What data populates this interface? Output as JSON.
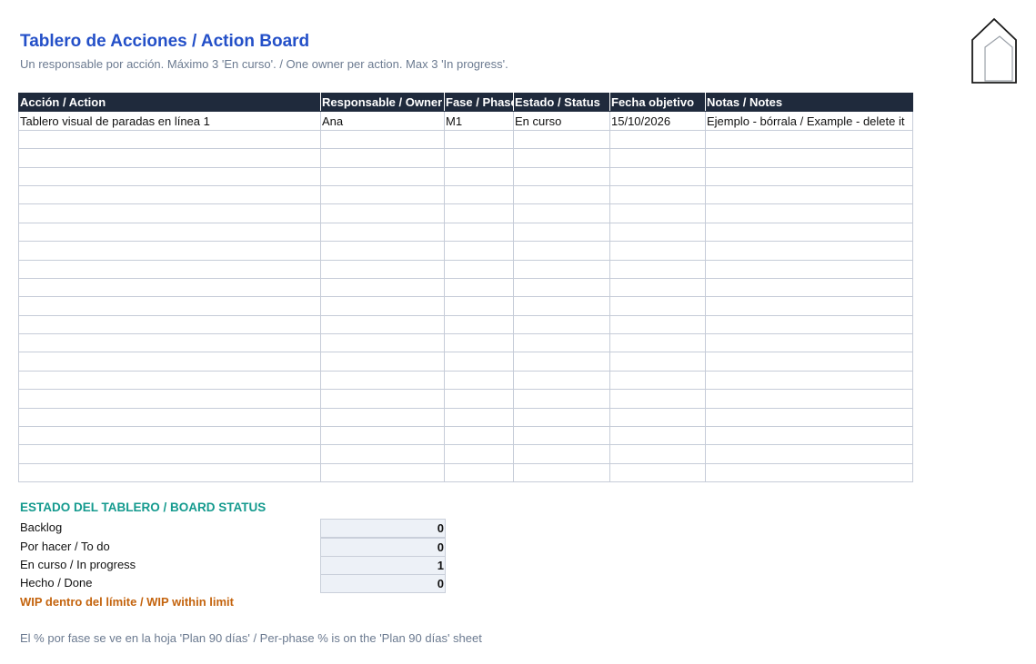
{
  "header": {
    "title": "Tablero de Acciones / Action Board",
    "subtitle": "Un responsable por acción. Máximo 3 'En curso'. / One owner per action. Max 3 'In progress'."
  },
  "table": {
    "columns": [
      "Acción / Action",
      "Responsable / Owner",
      "Fase / Phase",
      "Estado / Status",
      "Fecha objetivo",
      "Notas / Notes"
    ],
    "rows": [
      [
        "Tablero visual de paradas en línea 1",
        "Ana",
        "M1",
        "En curso",
        "15/10/2026",
        "Ejemplo - bórrala / Example - delete it"
      ],
      [
        "",
        "",
        "",
        "",
        "",
        ""
      ],
      [
        "",
        "",
        "",
        "",
        "",
        ""
      ],
      [
        "",
        "",
        "",
        "",
        "",
        ""
      ],
      [
        "",
        "",
        "",
        "",
        "",
        ""
      ],
      [
        "",
        "",
        "",
        "",
        "",
        ""
      ],
      [
        "",
        "",
        "",
        "",
        "",
        ""
      ],
      [
        "",
        "",
        "",
        "",
        "",
        ""
      ],
      [
        "",
        "",
        "",
        "",
        "",
        ""
      ],
      [
        "",
        "",
        "",
        "",
        "",
        ""
      ],
      [
        "",
        "",
        "",
        "",
        "",
        ""
      ],
      [
        "",
        "",
        "",
        "",
        "",
        ""
      ],
      [
        "",
        "",
        "",
        "",
        "",
        ""
      ],
      [
        "",
        "",
        "",
        "",
        "",
        ""
      ],
      [
        "",
        "",
        "",
        "",
        "",
        ""
      ],
      [
        "",
        "",
        "",
        "",
        "",
        ""
      ],
      [
        "",
        "",
        "",
        "",
        "",
        ""
      ],
      [
        "",
        "",
        "",
        "",
        "",
        ""
      ],
      [
        "",
        "",
        "",
        "",
        "",
        ""
      ],
      [
        "",
        "",
        "",
        "",
        "",
        ""
      ]
    ]
  },
  "board_status": {
    "title": "ESTADO DEL TABLERO / BOARD STATUS",
    "items": [
      {
        "label": "Backlog",
        "value": "0"
      },
      {
        "label": "Por hacer / To do",
        "value": "0"
      },
      {
        "label": "En curso / In progress",
        "value": "1"
      },
      {
        "label": "Hecho / Done",
        "value": "0"
      }
    ],
    "wip_message": "WIP dentro del límite / WIP within limit"
  },
  "footnote": "El % por fase se ve en la hoja 'Plan 90 días' / Per-phase % is on the 'Plan 90 días' sheet",
  "logo": {
    "icon": "house-outline-icon"
  },
  "colors": {
    "title": "#2450c8",
    "header_bg": "#1f2a3c",
    "status_title": "#149a8e",
    "wip": "#c4640e",
    "muted": "#6b7a90"
  }
}
